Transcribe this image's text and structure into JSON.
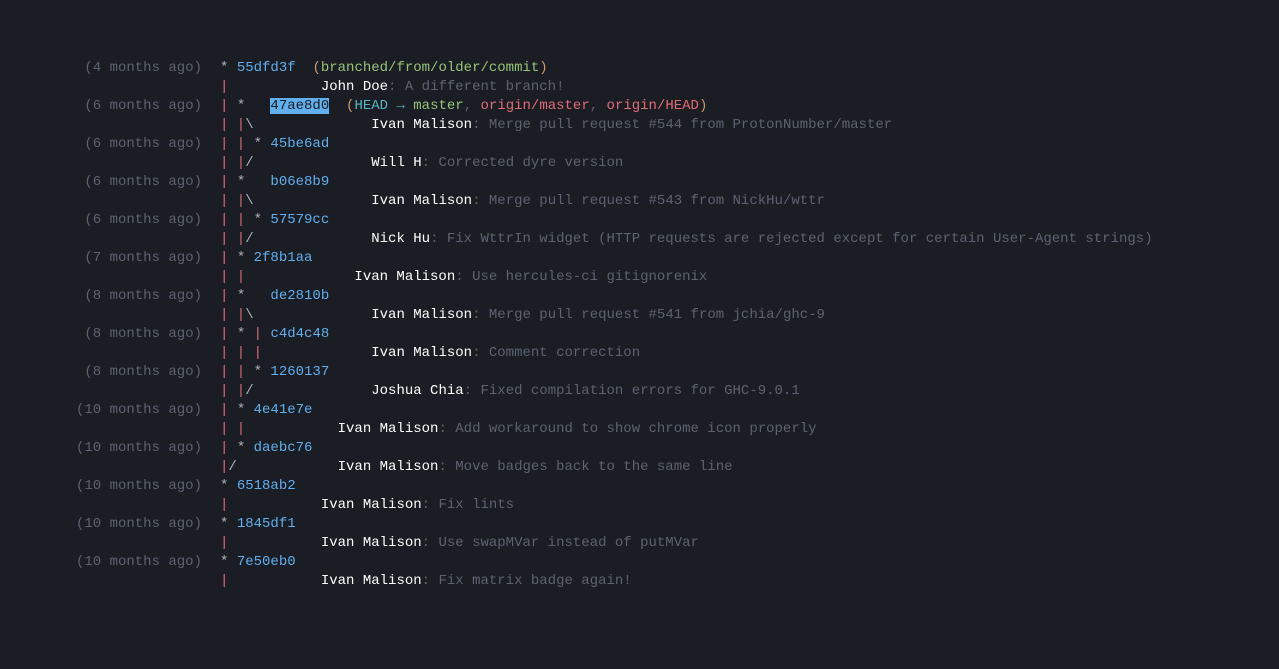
{
  "rows": [
    {
      "date": "(4 months ago)",
      "graph": [
        {
          "t": "star",
          "v": "* "
        }
      ],
      "hash": "55dfd3f",
      "hashHl": false,
      "sp": "  ",
      "refs": [
        {
          "t": "paren-y",
          "v": "("
        },
        {
          "t": "branchname",
          "v": "branched/from/older/commit"
        },
        {
          "t": "paren-y",
          "v": ")"
        }
      ]
    },
    {
      "date": "",
      "graph": [
        {
          "t": "branch-red",
          "v": "|           "
        }
      ],
      "author": "John Doe",
      "msg": "A different branch!"
    },
    {
      "date": "(6 months ago)",
      "graph": [
        {
          "t": "branch-red",
          "v": "| "
        },
        {
          "t": "star",
          "v": "*   "
        }
      ],
      "hash": "47ae8d0",
      "hashHl": true,
      "sp": "  ",
      "refs": [
        {
          "t": "paren-y",
          "v": "("
        },
        {
          "t": "head",
          "v": "HEAD "
        },
        {
          "t": "arrow",
          "v": "→ "
        },
        {
          "t": "master",
          "v": "master"
        },
        {
          "t": "colon",
          "v": ", "
        },
        {
          "t": "remote",
          "v": "origin/master"
        },
        {
          "t": "colon",
          "v": ", "
        },
        {
          "t": "remote",
          "v": "origin/HEAD"
        },
        {
          "t": "paren-y",
          "v": ")"
        }
      ]
    },
    {
      "date": "",
      "graph": [
        {
          "t": "branch-red",
          "v": "| |"
        },
        {
          "t": "star",
          "v": "\\              "
        }
      ],
      "author": "Ivan Malison",
      "msg": "Merge pull request #544 from ProtonNumber/master"
    },
    {
      "date": "(6 months ago)",
      "graph": [
        {
          "t": "branch-red",
          "v": "| | "
        },
        {
          "t": "star",
          "v": "* "
        }
      ],
      "hash": "45be6ad"
    },
    {
      "date": "",
      "graph": [
        {
          "t": "branch-red",
          "v": "| |"
        },
        {
          "t": "star",
          "v": "/              "
        }
      ],
      "author": "Will H",
      "msg": "Corrected dyre version"
    },
    {
      "date": "(6 months ago)",
      "graph": [
        {
          "t": "branch-red",
          "v": "| "
        },
        {
          "t": "star",
          "v": "*   "
        }
      ],
      "hash": "b06e8b9"
    },
    {
      "date": "",
      "graph": [
        {
          "t": "branch-red",
          "v": "| |"
        },
        {
          "t": "star",
          "v": "\\              "
        }
      ],
      "author": "Ivan Malison",
      "msg": "Merge pull request #543 from NickHu/wttr"
    },
    {
      "date": "(6 months ago)",
      "graph": [
        {
          "t": "branch-red",
          "v": "| | "
        },
        {
          "t": "star",
          "v": "* "
        }
      ],
      "hash": "57579cc"
    },
    {
      "date": "",
      "graph": [
        {
          "t": "branch-red",
          "v": "| |"
        },
        {
          "t": "star",
          "v": "/              "
        }
      ],
      "author": "Nick Hu",
      "msg": "Fix WttrIn widget (HTTP requests are rejected except for certain User-Agent strings)"
    },
    {
      "date": "(7 months ago)",
      "graph": [
        {
          "t": "branch-red",
          "v": "| "
        },
        {
          "t": "star",
          "v": "* "
        }
      ],
      "hash": "2f8b1aa"
    },
    {
      "date": "",
      "graph": [
        {
          "t": "branch-red",
          "v": "| |             "
        }
      ],
      "author": "Ivan Malison",
      "msg": "Use hercules-ci gitignorenix"
    },
    {
      "date": "(8 months ago)",
      "graph": [
        {
          "t": "branch-red",
          "v": "| "
        },
        {
          "t": "star",
          "v": "*   "
        }
      ],
      "hash": "de2810b"
    },
    {
      "date": "",
      "graph": [
        {
          "t": "branch-red",
          "v": "| |"
        },
        {
          "t": "star",
          "v": "\\              "
        }
      ],
      "author": "Ivan Malison",
      "msg": "Merge pull request #541 from jchia/ghc-9"
    },
    {
      "date": "(8 months ago)",
      "graph": [
        {
          "t": "branch-red",
          "v": "| "
        },
        {
          "t": "star",
          "v": "* "
        },
        {
          "t": "branch-red",
          "v": "| "
        }
      ],
      "hash": "c4d4c48"
    },
    {
      "date": "",
      "graph": [
        {
          "t": "branch-red",
          "v": "| | |             "
        }
      ],
      "author": "Ivan Malison",
      "msg": "Comment correction"
    },
    {
      "date": "(8 months ago)",
      "graph": [
        {
          "t": "branch-red",
          "v": "| | "
        },
        {
          "t": "star",
          "v": "* "
        }
      ],
      "hash": "1260137"
    },
    {
      "date": "",
      "graph": [
        {
          "t": "branch-red",
          "v": "| |"
        },
        {
          "t": "star",
          "v": "/              "
        }
      ],
      "author": "Joshua Chia",
      "msg": "Fixed compilation errors for GHC-9.0.1"
    },
    {
      "date": "(10 months ago)",
      "graph": [
        {
          "t": "branch-red",
          "v": "| "
        },
        {
          "t": "star",
          "v": "* "
        }
      ],
      "hash": "4e41e7e"
    },
    {
      "date": "",
      "graph": [
        {
          "t": "branch-red",
          "v": "| |           "
        }
      ],
      "author": "Ivan Malison",
      "msg": "Add workaround to show chrome icon properly"
    },
    {
      "date": "(10 months ago)",
      "graph": [
        {
          "t": "branch-red",
          "v": "| "
        },
        {
          "t": "star",
          "v": "* "
        }
      ],
      "hash": "daebc76"
    },
    {
      "date": "",
      "graph": [
        {
          "t": "branch-red",
          "v": "|"
        },
        {
          "t": "star",
          "v": "/            "
        }
      ],
      "author": "Ivan Malison",
      "msg": "Move badges back to the same line"
    },
    {
      "date": "(10 months ago)",
      "graph": [
        {
          "t": "star",
          "v": "* "
        }
      ],
      "hash": "6518ab2"
    },
    {
      "date": "",
      "graph": [
        {
          "t": "branch-red",
          "v": "|           "
        }
      ],
      "author": "Ivan Malison",
      "msg": "Fix lints"
    },
    {
      "date": "(10 months ago)",
      "graph": [
        {
          "t": "star",
          "v": "* "
        }
      ],
      "hash": "1845df1"
    },
    {
      "date": "",
      "graph": [
        {
          "t": "branch-red",
          "v": "|           "
        }
      ],
      "author": "Ivan Malison",
      "msg": "Use swapMVar instead of putMVar"
    },
    {
      "date": "(10 months ago)",
      "graph": [
        {
          "t": "star",
          "v": "* "
        }
      ],
      "hash": "7e50eb0"
    },
    {
      "date": "",
      "graph": [
        {
          "t": "branch-red",
          "v": "|           "
        }
      ],
      "author": "Ivan Malison",
      "msg": "Fix matrix badge again!"
    }
  ]
}
